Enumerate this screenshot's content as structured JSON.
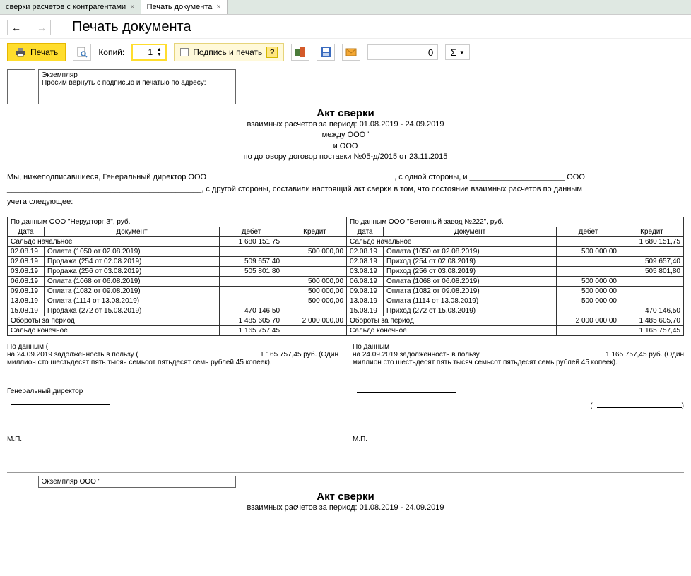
{
  "tabs": {
    "tab1": "сверки расчетов с контрагентами",
    "tab2": "Печать документа"
  },
  "header": {
    "title": "Печать документа"
  },
  "toolbar": {
    "print_label": "Печать",
    "copies_label": "Копий:",
    "copies_value": "1",
    "sign_label": "Подпись и печать",
    "num_value": "0",
    "sigma": "Σ"
  },
  "exemplar": {
    "line1": "Экземпляр",
    "line2": "Просим вернуть с подписью и печатью по адресу:"
  },
  "doc": {
    "title": "Акт сверки",
    "sub1": "взаимных расчетов за период: 01.08.2019 - 24.09.2019",
    "sub2": "между ООО '",
    "sub3": "и ООО",
    "sub4": "по договору договор поставки №05-д/2015 от 23.11.2015"
  },
  "preamble": {
    "p1": "Мы, нижеподписавшиеся, Генеральный директор ООО",
    "p2": ", с одной стороны, и ______________________  ООО",
    "p3": "_____________________________________________, с другой стороны, составили настоящий акт сверки в том, что состояние взаимных расчетов по данным",
    "p4": "учета следующее:"
  },
  "table": {
    "left_header": "По данным ООО \"Нерудторг З\", руб.",
    "right_header": "По данным ООО \"Бетонный завод №222\", руб.",
    "col_date": "Дата",
    "col_doc": "Документ",
    "col_debit": "Дебет",
    "col_credit": "Кредит",
    "saldo_start": "Сальдо начальное",
    "saldo_start_val": "1 680 151,75",
    "rows_left": [
      {
        "date": "02.08.19",
        "doc": "Оплата (1050 от 02.08.2019)",
        "debit": "",
        "credit": "500 000,00"
      },
      {
        "date": "02.08.19",
        "doc": "Продажа (254 от 02.08.2019)",
        "debit": "509 657,40",
        "credit": ""
      },
      {
        "date": "03.08.19",
        "doc": "Продажа (256 от 03.08.2019)",
        "debit": "505 801,80",
        "credit": ""
      },
      {
        "date": "06.08.19",
        "doc": "Оплата (1068 от 06.08.2019)",
        "debit": "",
        "credit": "500 000,00"
      },
      {
        "date": "09.08.19",
        "doc": "Оплата (1082 от 09.08.2019)",
        "debit": "",
        "credit": "500 000,00"
      },
      {
        "date": "13.08.19",
        "doc": "Оплата (1114 от 13.08.2019)",
        "debit": "",
        "credit": "500 000,00"
      },
      {
        "date": "15.08.19",
        "doc": "Продажа (272 от 15.08.2019)",
        "debit": "470 146,50",
        "credit": ""
      }
    ],
    "rows_right": [
      {
        "date": "02.08.19",
        "doc": "Оплата (1050 от 02.08.2019)",
        "debit": "500 000,00",
        "credit": ""
      },
      {
        "date": "02.08.19",
        "doc": "Приход (254 от 02.08.2019)",
        "debit": "",
        "credit": "509 657,40"
      },
      {
        "date": "03.08.19",
        "doc": "Приход (256 от 03.08.2019)",
        "debit": "",
        "credit": "505 801,80"
      },
      {
        "date": "06.08.19",
        "doc": "Оплата (1068 от 06.08.2019)",
        "debit": "500 000,00",
        "credit": ""
      },
      {
        "date": "09.08.19",
        "doc": "Оплата (1082 от 09.08.2019)",
        "debit": "500 000,00",
        "credit": ""
      },
      {
        "date": "13.08.19",
        "doc": "Оплата (1114 от 13.08.2019)",
        "debit": "500 000,00",
        "credit": ""
      },
      {
        "date": "15.08.19",
        "doc": "Приход (272 от 15.08.2019)",
        "debit": "",
        "credit": "470 146,50"
      }
    ],
    "turnover_label": "Обороты за период",
    "turnover_left_debit": "1 485 605,70",
    "turnover_left_credit": "2 000 000,00",
    "turnover_right_debit": "2 000 000,00",
    "turnover_right_credit": "1 485 605,70",
    "saldo_end": "Сальдо конечное",
    "saldo_end_left": "1 165 757,45",
    "saldo_end_right": "1 165 757,45"
  },
  "debt": {
    "left_l1": "По данным (",
    "left_l2": "на 24.09.2019 задолженность в пользу (",
    "left_amt": "1 165 757,45 руб. (Один",
    "left_l3": "миллион сто шестьдесят пять тысяч семьсот пятьдесят семь рублей 45 копеек).",
    "right_l1": "По данным",
    "right_l2": "на 24.09.2019 задолженность в пользу",
    "right_amt": "1 165 757,45 руб. (Один",
    "right_l3": "миллион сто шестьдесят пять тысяч семьсот пятьдесят семь рублей 45 копеек)."
  },
  "sig": {
    "gendir": "Генеральный директор",
    "mp": "М.П."
  },
  "exemplar2": "Экземпляр ООО '"
}
